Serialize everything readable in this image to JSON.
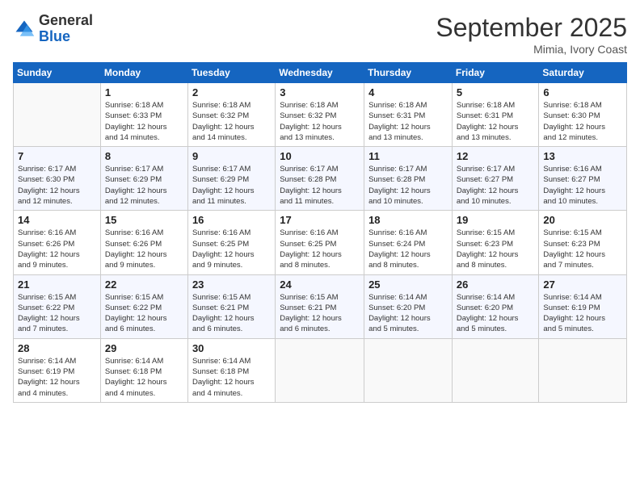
{
  "logo": {
    "general": "General",
    "blue": "Blue"
  },
  "title": "September 2025",
  "location": "Mimia, Ivory Coast",
  "days_header": [
    "Sunday",
    "Monday",
    "Tuesday",
    "Wednesday",
    "Thursday",
    "Friday",
    "Saturday"
  ],
  "weeks": [
    [
      {
        "num": "",
        "info": ""
      },
      {
        "num": "1",
        "info": "Sunrise: 6:18 AM\nSunset: 6:33 PM\nDaylight: 12 hours\nand 14 minutes."
      },
      {
        "num": "2",
        "info": "Sunrise: 6:18 AM\nSunset: 6:32 PM\nDaylight: 12 hours\nand 14 minutes."
      },
      {
        "num": "3",
        "info": "Sunrise: 6:18 AM\nSunset: 6:32 PM\nDaylight: 12 hours\nand 13 minutes."
      },
      {
        "num": "4",
        "info": "Sunrise: 6:18 AM\nSunset: 6:31 PM\nDaylight: 12 hours\nand 13 minutes."
      },
      {
        "num": "5",
        "info": "Sunrise: 6:18 AM\nSunset: 6:31 PM\nDaylight: 12 hours\nand 13 minutes."
      },
      {
        "num": "6",
        "info": "Sunrise: 6:18 AM\nSunset: 6:30 PM\nDaylight: 12 hours\nand 12 minutes."
      }
    ],
    [
      {
        "num": "7",
        "info": "Sunrise: 6:17 AM\nSunset: 6:30 PM\nDaylight: 12 hours\nand 12 minutes."
      },
      {
        "num": "8",
        "info": "Sunrise: 6:17 AM\nSunset: 6:29 PM\nDaylight: 12 hours\nand 12 minutes."
      },
      {
        "num": "9",
        "info": "Sunrise: 6:17 AM\nSunset: 6:29 PM\nDaylight: 12 hours\nand 11 minutes."
      },
      {
        "num": "10",
        "info": "Sunrise: 6:17 AM\nSunset: 6:28 PM\nDaylight: 12 hours\nand 11 minutes."
      },
      {
        "num": "11",
        "info": "Sunrise: 6:17 AM\nSunset: 6:28 PM\nDaylight: 12 hours\nand 10 minutes."
      },
      {
        "num": "12",
        "info": "Sunrise: 6:17 AM\nSunset: 6:27 PM\nDaylight: 12 hours\nand 10 minutes."
      },
      {
        "num": "13",
        "info": "Sunrise: 6:16 AM\nSunset: 6:27 PM\nDaylight: 12 hours\nand 10 minutes."
      }
    ],
    [
      {
        "num": "14",
        "info": "Sunrise: 6:16 AM\nSunset: 6:26 PM\nDaylight: 12 hours\nand 9 minutes."
      },
      {
        "num": "15",
        "info": "Sunrise: 6:16 AM\nSunset: 6:26 PM\nDaylight: 12 hours\nand 9 minutes."
      },
      {
        "num": "16",
        "info": "Sunrise: 6:16 AM\nSunset: 6:25 PM\nDaylight: 12 hours\nand 9 minutes."
      },
      {
        "num": "17",
        "info": "Sunrise: 6:16 AM\nSunset: 6:25 PM\nDaylight: 12 hours\nand 8 minutes."
      },
      {
        "num": "18",
        "info": "Sunrise: 6:16 AM\nSunset: 6:24 PM\nDaylight: 12 hours\nand 8 minutes."
      },
      {
        "num": "19",
        "info": "Sunrise: 6:15 AM\nSunset: 6:23 PM\nDaylight: 12 hours\nand 8 minutes."
      },
      {
        "num": "20",
        "info": "Sunrise: 6:15 AM\nSunset: 6:23 PM\nDaylight: 12 hours\nand 7 minutes."
      }
    ],
    [
      {
        "num": "21",
        "info": "Sunrise: 6:15 AM\nSunset: 6:22 PM\nDaylight: 12 hours\nand 7 minutes."
      },
      {
        "num": "22",
        "info": "Sunrise: 6:15 AM\nSunset: 6:22 PM\nDaylight: 12 hours\nand 6 minutes."
      },
      {
        "num": "23",
        "info": "Sunrise: 6:15 AM\nSunset: 6:21 PM\nDaylight: 12 hours\nand 6 minutes."
      },
      {
        "num": "24",
        "info": "Sunrise: 6:15 AM\nSunset: 6:21 PM\nDaylight: 12 hours\nand 6 minutes."
      },
      {
        "num": "25",
        "info": "Sunrise: 6:14 AM\nSunset: 6:20 PM\nDaylight: 12 hours\nand 5 minutes."
      },
      {
        "num": "26",
        "info": "Sunrise: 6:14 AM\nSunset: 6:20 PM\nDaylight: 12 hours\nand 5 minutes."
      },
      {
        "num": "27",
        "info": "Sunrise: 6:14 AM\nSunset: 6:19 PM\nDaylight: 12 hours\nand 5 minutes."
      }
    ],
    [
      {
        "num": "28",
        "info": "Sunrise: 6:14 AM\nSunset: 6:19 PM\nDaylight: 12 hours\nand 4 minutes."
      },
      {
        "num": "29",
        "info": "Sunrise: 6:14 AM\nSunset: 6:18 PM\nDaylight: 12 hours\nand 4 minutes."
      },
      {
        "num": "30",
        "info": "Sunrise: 6:14 AM\nSunset: 6:18 PM\nDaylight: 12 hours\nand 4 minutes."
      },
      {
        "num": "",
        "info": ""
      },
      {
        "num": "",
        "info": ""
      },
      {
        "num": "",
        "info": ""
      },
      {
        "num": "",
        "info": ""
      }
    ]
  ]
}
